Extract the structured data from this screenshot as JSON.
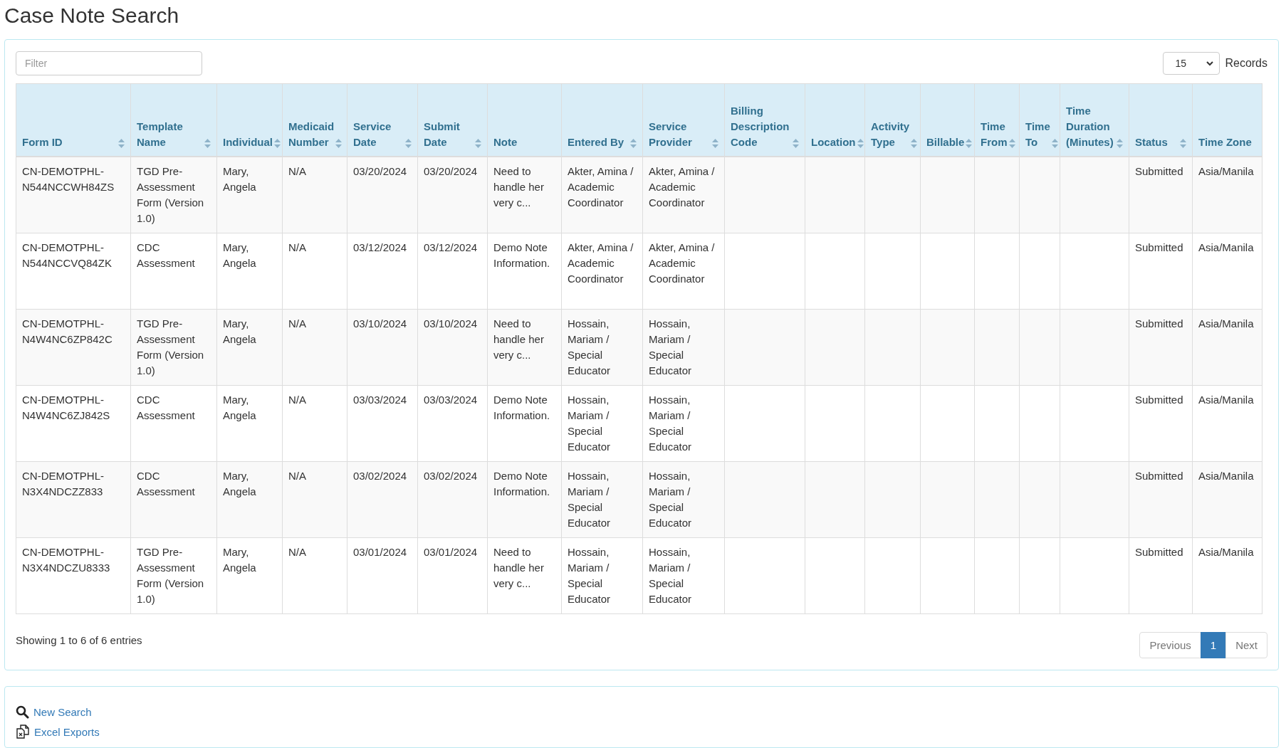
{
  "page_title": "Case Note Search",
  "filter": {
    "placeholder": "Filter"
  },
  "records": {
    "value": "15",
    "label": "Records"
  },
  "table": {
    "columns": [
      {
        "label": "Form ID",
        "sortable": true
      },
      {
        "label": "Template Name",
        "sortable": true
      },
      {
        "label": "Individual",
        "sortable": true
      },
      {
        "label": "Medicaid Number",
        "sortable": true
      },
      {
        "label": "Service Date",
        "sortable": true
      },
      {
        "label": "Submit Date",
        "sortable": true
      },
      {
        "label": "Note",
        "sortable": false
      },
      {
        "label": "Entered By",
        "sortable": true
      },
      {
        "label": "Service Provider",
        "sortable": true
      },
      {
        "label": "Billing Description Code",
        "sortable": true
      },
      {
        "label": "Location",
        "sortable": true
      },
      {
        "label": "Activity Type",
        "sortable": true
      },
      {
        "label": "Billable",
        "sortable": true
      },
      {
        "label": "Time From",
        "sortable": true
      },
      {
        "label": "Time To",
        "sortable": true
      },
      {
        "label": "Time Duration (Minutes)",
        "sortable": true
      },
      {
        "label": "Status",
        "sortable": true
      },
      {
        "label": "Time Zone",
        "sortable": false
      }
    ],
    "rows": [
      {
        "form_id": "CN-DEMOTPHL-N544NCCWH84ZS",
        "template_name": "TGD Pre-Assessment Form (Version 1.0)",
        "individual": "Mary, Angela",
        "medicaid_number": "N/A",
        "service_date": "03/20/2024",
        "submit_date": "03/20/2024",
        "note": "Need to handle her very c...",
        "entered_by": "Akter, Amina / Academic Coordinator",
        "service_provider": "Akter, Amina / Academic Coordinator",
        "status": "Submitted",
        "time_zone": "Asia/Manila"
      },
      {
        "form_id": "CN-DEMOTPHL-N544NCCVQ84ZK",
        "template_name": "CDC Assessment",
        "individual": "Mary, Angela",
        "medicaid_number": "N/A",
        "service_date": "03/12/2024",
        "submit_date": "03/12/2024",
        "note": "Demo Note Information.",
        "entered_by": "Akter, Amina / Academic Coordinator",
        "service_provider": "Akter, Amina / Academic Coordinator",
        "status": "Submitted",
        "time_zone": "Asia/Manila"
      },
      {
        "form_id": "CN-DEMOTPHL-N4W4NC6ZP842C",
        "template_name": "TGD Pre-Assessment Form (Version 1.0)",
        "individual": "Mary, Angela",
        "medicaid_number": "N/A",
        "service_date": "03/10/2024",
        "submit_date": "03/10/2024",
        "note": "Need to handle her very c...",
        "entered_by": "Hossain, Mariam / Special Educator",
        "service_provider": "Hossain, Mariam / Special Educator",
        "status": "Submitted",
        "time_zone": "Asia/Manila"
      },
      {
        "form_id": "CN-DEMOTPHL-N4W4NC6ZJ842S",
        "template_name": "CDC Assessment",
        "individual": "Mary, Angela",
        "medicaid_number": "N/A",
        "service_date": "03/03/2024",
        "submit_date": "03/03/2024",
        "note": "Demo Note Information.",
        "entered_by": "Hossain, Mariam / Special Educator",
        "service_provider": "Hossain, Mariam / Special Educator",
        "status": "Submitted",
        "time_zone": "Asia/Manila"
      },
      {
        "form_id": "CN-DEMOTPHL-N3X4NDCZZ833",
        "template_name": "CDC Assessment",
        "individual": "Mary, Angela",
        "medicaid_number": "N/A",
        "service_date": "03/02/2024",
        "submit_date": "03/02/2024",
        "note": "Demo Note Information.",
        "entered_by": "Hossain, Mariam / Special Educator",
        "service_provider": "Hossain, Mariam / Special Educator",
        "status": "Submitted",
        "time_zone": "Asia/Manila"
      },
      {
        "form_id": "CN-DEMOTPHL-N3X4NDCZU8333",
        "template_name": "TGD Pre-Assessment Form (Version 1.0)",
        "individual": "Mary, Angela",
        "medicaid_number": "N/A",
        "service_date": "03/01/2024",
        "submit_date": "03/01/2024",
        "note": "Need to handle her very c...",
        "entered_by": "Hossain, Mariam / Special Educator",
        "service_provider": "Hossain, Mariam / Special Educator",
        "status": "Submitted",
        "time_zone": "Asia/Manila"
      }
    ]
  },
  "info": "Showing 1 to 6 of 6 entries",
  "pagination": [
    {
      "label": "Previous",
      "selected": false
    },
    {
      "label": "1",
      "selected": true
    },
    {
      "label": "Next",
      "selected": false
    }
  ],
  "actions": [
    {
      "kind": "search",
      "label": "New Search"
    },
    {
      "kind": "export",
      "label": "Excel Exports"
    }
  ]
}
